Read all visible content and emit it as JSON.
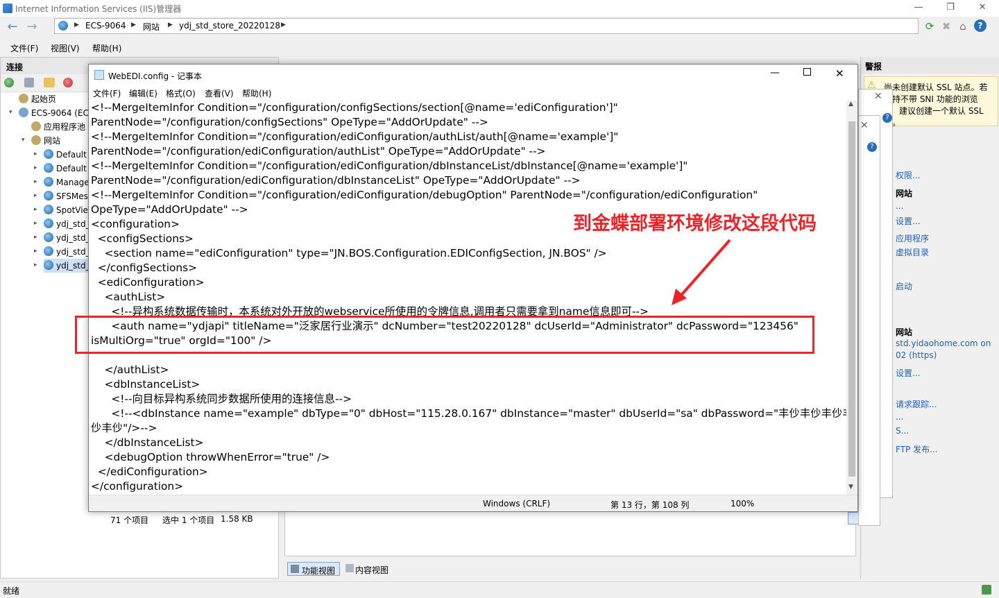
{
  "window": {
    "title": "Internet Information Services (IIS)管理器",
    "minimize": "—",
    "maximize": "❐",
    "close": "✕"
  },
  "address": {
    "segments": [
      "ECS-9064",
      "网站",
      "ydj_std_store_20220128"
    ]
  },
  "menubar": [
    "文件(F)",
    "视图(V)",
    "帮助(H)"
  ],
  "connections": {
    "header": "连接",
    "tree": [
      {
        "label": "起始页",
        "level": 1
      },
      {
        "label": "ECS-9064 (ECS",
        "level": 0
      },
      {
        "label": "应用程序池",
        "level": 1
      },
      {
        "label": "网站",
        "level": 1
      },
      {
        "label": "Default",
        "level": 2
      },
      {
        "label": "Default",
        "level": 2
      },
      {
        "label": "Manage",
        "level": 2
      },
      {
        "label": "SFSMes",
        "level": 2
      },
      {
        "label": "SpotVie",
        "level": 2
      },
      {
        "label": "ydj_std_",
        "level": 2
      },
      {
        "label": "ydj_std_",
        "level": 2
      },
      {
        "label": "ydj_std_",
        "level": 2
      },
      {
        "label": "ydj_std_",
        "level": 2
      }
    ],
    "status": {
      "count": "71 个项目",
      "selected": "选中 1 个项目",
      "size": "1.58 KB"
    }
  },
  "center": {
    "feature_view": "功能视图",
    "content_view": "内容视图"
  },
  "actions": {
    "header": "警报",
    "alert_lines": [
      "尚未创建默认 SSL 站点。若",
      "支持不带 SNI 功能的浏览",
      "建议创建一个默认 SSL",
      "点。"
    ],
    "items": [
      {
        "text": "权限...",
        "link": true
      },
      {
        "text": "网站",
        "link": false
      },
      {
        "text": "...",
        "link": true
      },
      {
        "text": "设置...",
        "link": true
      },
      {
        "text": "应用程序",
        "link": true
      },
      {
        "text": "虚拟目录",
        "link": true
      },
      {
        "text": "启动",
        "link": true
      },
      {
        "text": "网站",
        "link": false
      },
      {
        "text": "std.yidaohome.com on",
        "link": true
      },
      {
        "text": "02 (https)",
        "link": true
      },
      {
        "text": "设置...",
        "link": true
      },
      {
        "text": "请求跟踪...",
        "link": true
      },
      {
        "text": "...",
        "link": true
      },
      {
        "text": "S...",
        "link": true
      },
      {
        "text": "FTP 发布...",
        "link": true
      }
    ]
  },
  "notepad": {
    "title": "WebEDI.config - 记事本",
    "menu": [
      "文件(F)",
      "编辑(E)",
      "格式(O)",
      "查看(V)",
      "帮助(H)"
    ],
    "lines": [
      "<!--MergeItemInfor Condition=\"/configuration/configSections/section[@name='ediConfiguration']\"",
      "ParentNode=\"/configuration/configSections\" OpeType=\"AddOrUpdate\" -->",
      "<!--MergeItemInfor Condition=\"/configuration/ediConfiguration/authList/auth[@name='example']\"",
      "ParentNode=\"/configuration/ediConfiguration/authList\" OpeType=\"AddOrUpdate\" -->",
      "<!--MergeItemInfor Condition=\"/configuration/ediConfiguration/dbInstanceList/dbInstance[@name='example']\"",
      "ParentNode=\"/configuration/ediConfiguration/dbInstanceList\" OpeType=\"AddOrUpdate\" -->",
      "<!--MergeItemInfor Condition=\"/configuration/ediConfiguration/debugOption\" ParentNode=\"/configuration/ediConfiguration\"",
      "OpeType=\"AddOrUpdate\" -->",
      "<configuration>",
      "  <configSections>",
      "    <section name=\"ediConfiguration\" type=\"JN.BOS.Configuration.EDIConfigSection, JN.BOS\" />",
      "  </configSections>",
      "  <ediConfiguration>",
      "    <authList>",
      "      <!--异构系统数据传输时，本系统对外开放的webservice所使用的令牌信息,调用者只需要拿到name信息即可-->",
      "      <auth name=\"ydjapi\" titleName=\"泛家居行业演示\" dcNumber=\"test20220128\" dcUserId=\"Administrator\" dcPassword=\"123456\"",
      "isMultiOrg=\"true\" orgId=\"100\" />",
      "",
      "    </authList>",
      "    <dbInstanceList>",
      "      <!--向目标异构系统同步数据所使用的连接信息-->",
      "      <!--<dbInstance name=\"example\" dbType=\"0\" dbHost=\"115.28.0.167\" dbInstance=\"master\" dbUserId=\"sa\" dbPassword=\"丰仯丰仯丰仯丰",
      "仯丰仯\"/>-->",
      "    </dbInstanceList>",
      "    <debugOption throwWhenError=\"true\" />",
      "  </ediConfiguration>",
      "</configuration>"
    ],
    "status": {
      "encoding": "Windows (CRLF)",
      "position": "第 13 行，第 108 列",
      "zoom": "100%"
    }
  },
  "annotation": {
    "text": "到金蝶部署环境修改这段代码",
    "color": "#e8252b"
  },
  "statusbar": {
    "text": "就绪"
  }
}
